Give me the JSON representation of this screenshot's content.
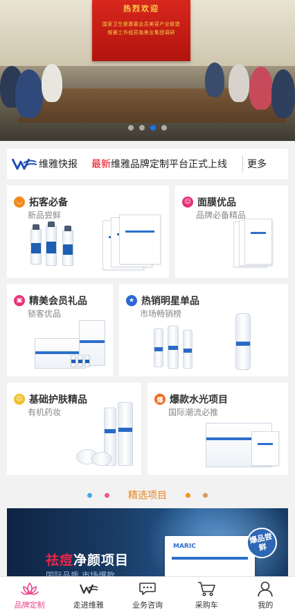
{
  "banner": {
    "screen_line1": "热烈欢迎",
    "screen_line2": "国家卫生健康委会员美容产业联盟",
    "screen_line3": "维雅工作组莅临美业集团调研",
    "dots_count": 4,
    "active_dot": 2
  },
  "news": {
    "brand": "维雅快报",
    "tag": "最新",
    "text": "维雅品牌定制平台正式上线",
    "more": "更多"
  },
  "cards": [
    {
      "title": "拓客必备",
      "subtitle": "新品尝鲜",
      "icon": "smile-icon",
      "color": "#f08a1c"
    },
    {
      "title": "面膜优品",
      "subtitle": "品牌必备精品",
      "icon": "face-icon",
      "color": "#e8337a"
    },
    {
      "title": "精美会员礼品",
      "subtitle": "锁客优品",
      "icon": "gift-icon",
      "color": "#e8337a"
    },
    {
      "title": "热销明星单品",
      "subtitle": "市场畅销榜",
      "icon": "star-icon",
      "color": "#2d67d8"
    },
    {
      "title": "基础护肤精品",
      "subtitle": "有机药妆",
      "icon": "leaf-icon",
      "color": "#f2c12e"
    },
    {
      "title": "爆款水光项目",
      "subtitle": "国际潮流必推",
      "icon": "fire-icon",
      "color": "#f06a1c",
      "icon_text": "爆"
    }
  ],
  "section": {
    "title": "精选项目"
  },
  "promo": {
    "title_red": "祛痘",
    "title_white": "净颜项目",
    "subtitle": "国际品质 市场爆款",
    "badge": "爆品尝鲜",
    "pack_brand": "MARIC"
  },
  "product_brand": "MARIC",
  "tabs": [
    {
      "label": "品牌定制",
      "icon": "lotus-icon",
      "active": true
    },
    {
      "label": "走进维雅",
      "icon": "weiya-logo-icon",
      "active": false
    },
    {
      "label": "业务咨询",
      "icon": "chat-icon",
      "active": false
    },
    {
      "label": "采购车",
      "icon": "cart-icon",
      "active": false
    },
    {
      "label": "我的",
      "icon": "user-icon",
      "active": false
    }
  ],
  "colors": {
    "accent_blue": "#1a73e8",
    "news_red": "#e60012",
    "section_orange": "#e8831c",
    "tab_active": "#e8458b"
  }
}
